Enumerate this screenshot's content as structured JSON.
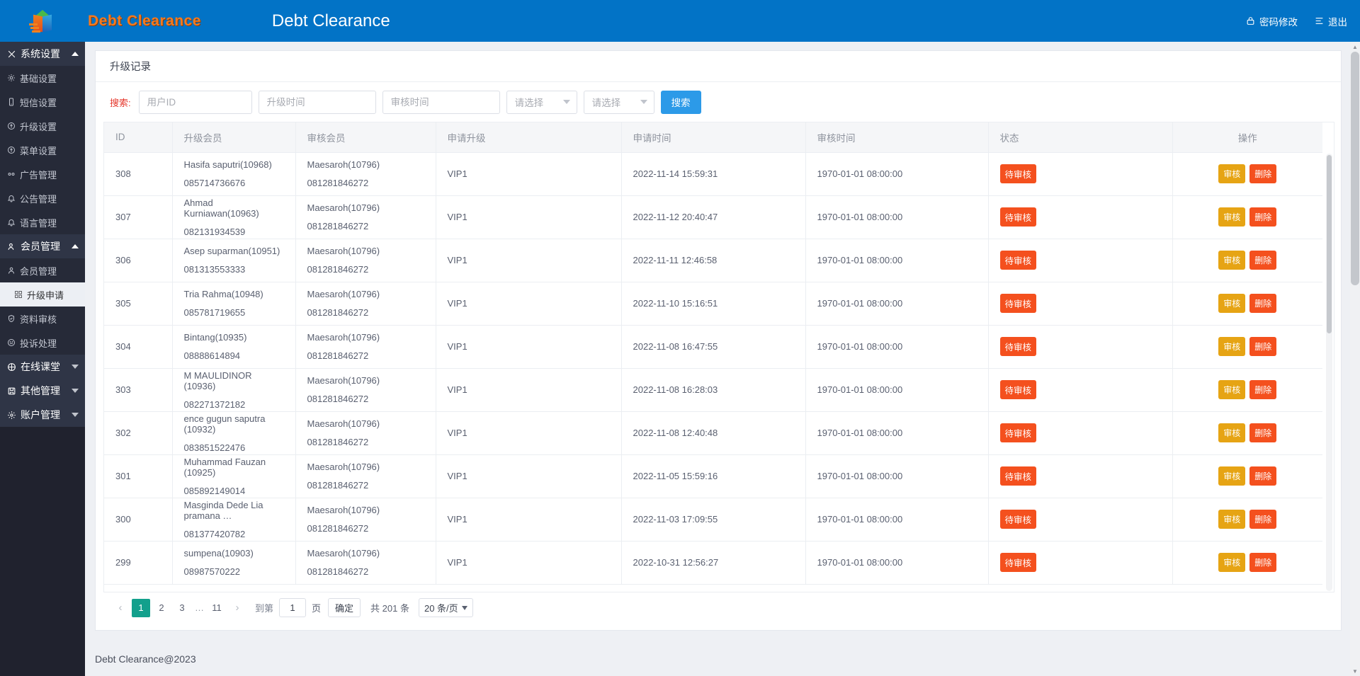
{
  "header": {
    "brand_text": "Debt Clearance",
    "title": "Debt Clearance",
    "change_password": "密码修改",
    "logout": "退出",
    "bg_color": "#0273c6"
  },
  "sidebar": {
    "groups": [
      {
        "label": "系统设置",
        "icon": "tools-icon",
        "expanded": true,
        "items": [
          {
            "label": "基础设置",
            "icon": "gear-icon",
            "active": false
          },
          {
            "label": "短信设置",
            "icon": "mobile-icon",
            "active": false
          },
          {
            "label": "升级设置",
            "icon": "upgrade-icon",
            "active": false
          },
          {
            "label": "菜单设置",
            "icon": "menu-icon",
            "active": false
          },
          {
            "label": "广告管理",
            "icon": "ad-icon",
            "active": false
          },
          {
            "label": "公告管理",
            "icon": "bell-icon",
            "active": false
          },
          {
            "label": "语言管理",
            "icon": "bell-icon",
            "active": false
          }
        ]
      },
      {
        "label": "会员管理",
        "icon": "members-icon",
        "expanded": true,
        "items": [
          {
            "label": "会员管理",
            "icon": "user-icon",
            "active": false
          },
          {
            "label": "升级申请",
            "icon": "grid-icon",
            "active": true
          },
          {
            "label": "资料审核",
            "icon": "shield-icon",
            "active": false
          },
          {
            "label": "投诉处理",
            "icon": "sad-face-icon",
            "active": false
          }
        ]
      },
      {
        "label": "在线课堂",
        "icon": "globe-icon",
        "expanded": false,
        "items": []
      },
      {
        "label": "其他管理",
        "icon": "save-icon",
        "expanded": false,
        "items": []
      },
      {
        "label": "账户管理",
        "icon": "gear-icon",
        "expanded": false,
        "items": []
      }
    ]
  },
  "card": {
    "title": "升级记录"
  },
  "search": {
    "label": "搜索:",
    "user_id_placeholder": "用户ID",
    "upgrade_time_placeholder": "升级时间",
    "review_time_placeholder": "审核时间",
    "select_1": "请选择",
    "select_2": "请选择",
    "button": "搜索",
    "button_color": "#2c9ae8"
  },
  "table": {
    "columns": [
      "ID",
      "升级会员",
      "审核会员",
      "申请升级",
      "申请时间",
      "审核时间",
      "状态",
      "操作"
    ],
    "status_color": "#f4501e",
    "review_button": "审核",
    "delete_button": "删除",
    "review_color": "#e6a414",
    "delete_color": "#f4501e",
    "rows": [
      {
        "id": "308",
        "member_name": "Hasifa saputri(10968)",
        "member_phone": "085714736676",
        "reviewer_name": "Maesaroh(10796)",
        "reviewer_phone": "081281846272",
        "level": "VIP1",
        "apply_time": "2022-11-14 15:59:31",
        "review_time": "1970-01-01 08:00:00",
        "status": "待审核"
      },
      {
        "id": "307",
        "member_name": "Ahmad Kurniawan(10963)",
        "member_phone": "082131934539",
        "reviewer_name": "Maesaroh(10796)",
        "reviewer_phone": "081281846272",
        "level": "VIP1",
        "apply_time": "2022-11-12 20:40:47",
        "review_time": "1970-01-01 08:00:00",
        "status": "待审核"
      },
      {
        "id": "306",
        "member_name": "Asep suparman(10951)",
        "member_phone": "081313553333",
        "reviewer_name": "Maesaroh(10796)",
        "reviewer_phone": "081281846272",
        "level": "VIP1",
        "apply_time": "2022-11-11 12:46:58",
        "review_time": "1970-01-01 08:00:00",
        "status": "待审核"
      },
      {
        "id": "305",
        "member_name": "Tria Rahma(10948)",
        "member_phone": "085781719655",
        "reviewer_name": "Maesaroh(10796)",
        "reviewer_phone": "081281846272",
        "level": "VIP1",
        "apply_time": "2022-11-10 15:16:51",
        "review_time": "1970-01-01 08:00:00",
        "status": "待审核"
      },
      {
        "id": "304",
        "member_name": "Bintang(10935)",
        "member_phone": "08888614894",
        "reviewer_name": "Maesaroh(10796)",
        "reviewer_phone": "081281846272",
        "level": "VIP1",
        "apply_time": "2022-11-08 16:47:55",
        "review_time": "1970-01-01 08:00:00",
        "status": "待审核"
      },
      {
        "id": "303",
        "member_name": "M MAULIDINOR (10936)",
        "member_phone": "082271372182",
        "reviewer_name": "Maesaroh(10796)",
        "reviewer_phone": "081281846272",
        "level": "VIP1",
        "apply_time": "2022-11-08 16:28:03",
        "review_time": "1970-01-01 08:00:00",
        "status": "待审核"
      },
      {
        "id": "302",
        "member_name": "ence gugun saputra (10932)",
        "member_phone": "083851522476",
        "reviewer_name": "Maesaroh(10796)",
        "reviewer_phone": "081281846272",
        "level": "VIP1",
        "apply_time": "2022-11-08 12:40:48",
        "review_time": "1970-01-01 08:00:00",
        "status": "待审核"
      },
      {
        "id": "301",
        "member_name": "Muhammad Fauzan (10925)",
        "member_phone": "085892149014",
        "reviewer_name": "Maesaroh(10796)",
        "reviewer_phone": "081281846272",
        "level": "VIP1",
        "apply_time": "2022-11-05 15:59:16",
        "review_time": "1970-01-01 08:00:00",
        "status": "待审核"
      },
      {
        "id": "300",
        "member_name": "Masginda Dede Lia pramana …",
        "member_phone": "081377420782",
        "reviewer_name": "Maesaroh(10796)",
        "reviewer_phone": "081281846272",
        "level": "VIP1",
        "apply_time": "2022-11-03 17:09:55",
        "review_time": "1970-01-01 08:00:00",
        "status": "待审核"
      },
      {
        "id": "299",
        "member_name": "sumpena(10903)",
        "member_phone": "08987570222",
        "reviewer_name": "Maesaroh(10796)",
        "reviewer_phone": "081281846272",
        "level": "VIP1",
        "apply_time": "2022-10-31 12:56:27",
        "review_time": "1970-01-01 08:00:00",
        "status": "待审核"
      }
    ]
  },
  "pagination": {
    "prev": "‹",
    "next": "›",
    "pages": [
      "1",
      "2",
      "3"
    ],
    "gap": "…",
    "last_page": "11",
    "current_page": "1",
    "goto_label": "到第",
    "goto_value": "1",
    "page_unit": "页",
    "confirm": "确定",
    "total": "共 201 条",
    "page_size": "20 条/页",
    "active_color": "#13a08c"
  },
  "footer": {
    "text": "Debt Clearance@2023"
  }
}
